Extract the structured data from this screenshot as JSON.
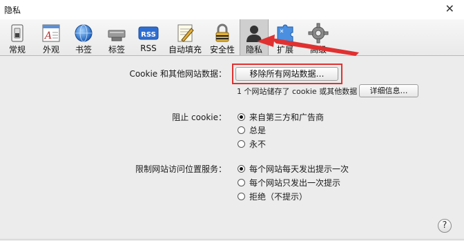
{
  "window": {
    "title": "隐私",
    "close_glyph": "✕"
  },
  "toolbar": {
    "items": [
      {
        "label": "常规",
        "icon": "general-switch-icon"
      },
      {
        "label": "外观",
        "icon": "appearance-font-icon"
      },
      {
        "label": "书签",
        "icon": "bookmarks-globe-icon"
      },
      {
        "label": "标签",
        "icon": "tabs-icon"
      },
      {
        "label": "RSS",
        "icon": "rss-icon"
      },
      {
        "label": "自动填充",
        "icon": "autofill-pencil-icon"
      },
      {
        "label": "安全性",
        "icon": "security-lock-icon"
      },
      {
        "label": "隐私",
        "icon": "privacy-person-icon",
        "selected": true
      },
      {
        "label": "扩展",
        "icon": "extensions-puzzle-icon"
      },
      {
        "label": "高级",
        "icon": "advanced-gear-icon"
      }
    ],
    "rss_text": "RSS"
  },
  "cookies": {
    "label": "Cookie 和其他网站数据：",
    "remove_button": "移除所有网站数据…",
    "info": "1 个网站储存了 cookie 或其他数据",
    "details_button": "详细信息…"
  },
  "block_cookies": {
    "label": "阻止 cookie：",
    "options": [
      "来自第三方和广告商",
      "总是",
      "永不"
    ],
    "selected": 0
  },
  "location": {
    "label": "限制网站访问位置服务：",
    "options": [
      "每个网站每天发出提示一次",
      "每个网站只发出一次提示",
      "拒绝（不提示）"
    ],
    "selected": 0
  },
  "help": {
    "glyph": "?"
  },
  "colors": {
    "highlight": "#e03030",
    "selected_tab": "#cfcfcf",
    "content_bg": "#ececec"
  }
}
